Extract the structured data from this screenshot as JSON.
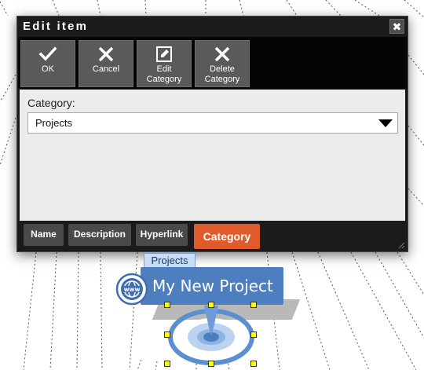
{
  "dialog": {
    "title": "Edit item",
    "close_glyph": "✖",
    "toolbar": [
      {
        "icon": "checkmark-icon",
        "label": "OK"
      },
      {
        "icon": "x-icon",
        "label": "Cancel"
      },
      {
        "icon": "edit-icon",
        "label": "Edit\nCategory"
      },
      {
        "icon": "x-icon",
        "label": "Delete\nCategory"
      }
    ],
    "category_label": "Category:",
    "category_value": "Projects",
    "tabs": [
      {
        "label": "Name",
        "active": false
      },
      {
        "label": "Description",
        "active": false
      },
      {
        "label": "Hyperlink",
        "active": false
      },
      {
        "label": "Category",
        "active": true
      }
    ]
  },
  "node": {
    "category_tag": "Projects",
    "title": "My New Project",
    "icon": "www-globe-icon"
  },
  "colors": {
    "dialog_bg": "#1b1b1b",
    "active_tab": "#e15a29",
    "node_blue": "#4d7ec0"
  }
}
